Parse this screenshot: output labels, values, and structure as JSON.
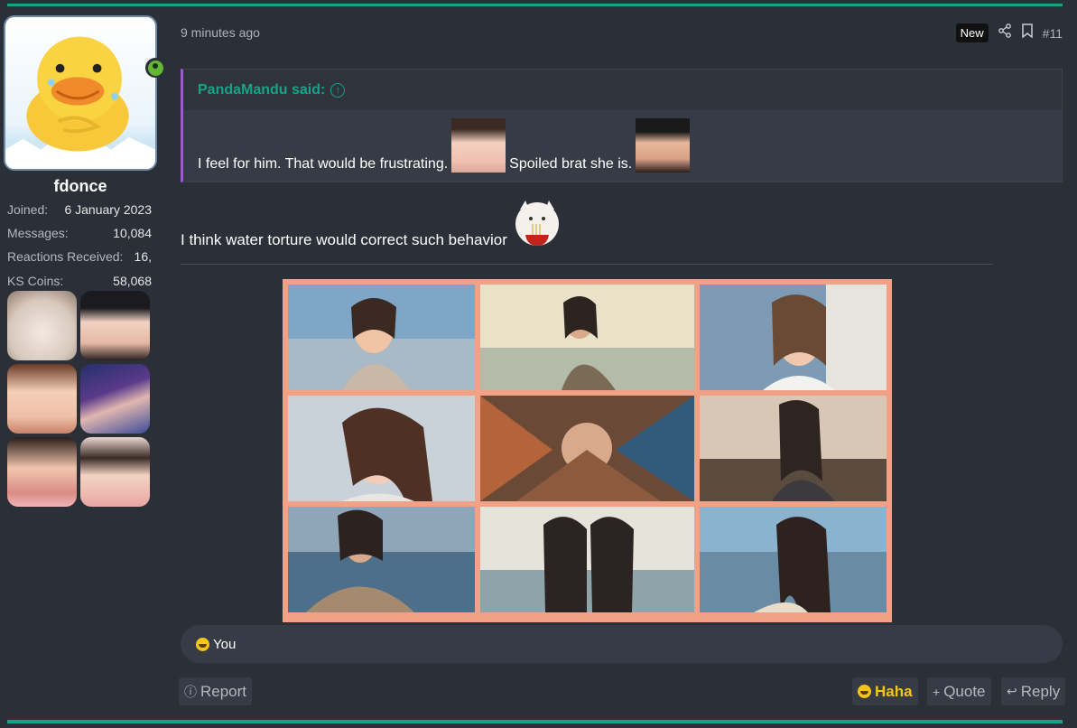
{
  "user": {
    "name": "fdonce",
    "stats": [
      {
        "key": "Joined:",
        "value": "6 January 2023"
      },
      {
        "key": "Messages:",
        "value": "10,084"
      },
      {
        "key": "Reactions Received:",
        "value": "16,"
      },
      {
        "key": "KS Coins:",
        "value": "58,068"
      }
    ],
    "online_color": "#64b735"
  },
  "post": {
    "time_ago": "9 minutes ago",
    "new_badge": "New",
    "number": "#11",
    "quote": {
      "author": "PandaMandu said:",
      "text_part1": "I feel for him. That would be frustrating.",
      "text_part2": "Spoiled brat she is."
    },
    "body": "I think water torture would correct such behavior"
  },
  "reactions": {
    "summary": "You"
  },
  "actions": {
    "report": "Report",
    "haha": "Haha",
    "quote": "Quote",
    "reply": "Reply"
  },
  "colors": {
    "accent": "#17a389",
    "quote_border": "#9b59d3",
    "collage_frame": "#f1a186",
    "haha": "#f5c518"
  }
}
